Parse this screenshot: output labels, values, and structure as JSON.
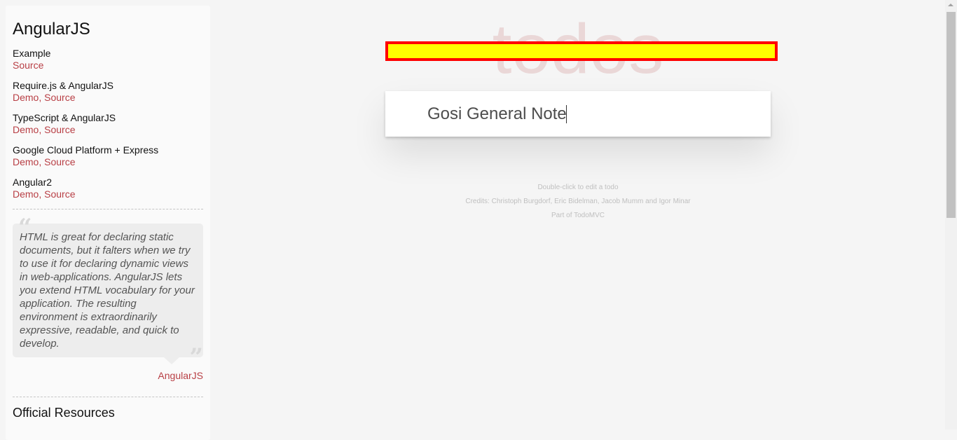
{
  "sidebar": {
    "title": "AngularJS",
    "examples": [
      {
        "name": "Example",
        "links": [
          "Source"
        ]
      },
      {
        "name": "Require.js & AngularJS",
        "links": [
          "Demo",
          "Source"
        ]
      },
      {
        "name": "TypeScript & AngularJS",
        "links": [
          "Demo",
          "Source"
        ]
      },
      {
        "name": "Google Cloud Platform + Express",
        "links": [
          "Demo",
          "Source"
        ]
      },
      {
        "name": "Angular2",
        "links": [
          "Demo",
          "Source"
        ]
      }
    ],
    "quote": {
      "text": "HTML is great for declaring static documents, but it falters when we try to use it for declaring dynamic views in web-applications. AngularJS lets you extend HTML vocabulary for your application. The resulting environment is extraordinarily expressive, readable, and quick to develop.",
      "attribution": "AngularJS"
    },
    "resources_title": "Official Resources"
  },
  "app": {
    "title": "todos",
    "new_todo_value": "Gosi General Note"
  },
  "footer": {
    "line1": "Double-click to edit a todo",
    "line2": "Credits: Christoph Burgdorf, Eric Bidelman, Jacob Mumm and Igor Minar",
    "line3": "Part of TodoMVC"
  },
  "colors": {
    "accent": "#b83f45",
    "highlight_fill": "#ffff00",
    "highlight_border": "#ff0000"
  }
}
